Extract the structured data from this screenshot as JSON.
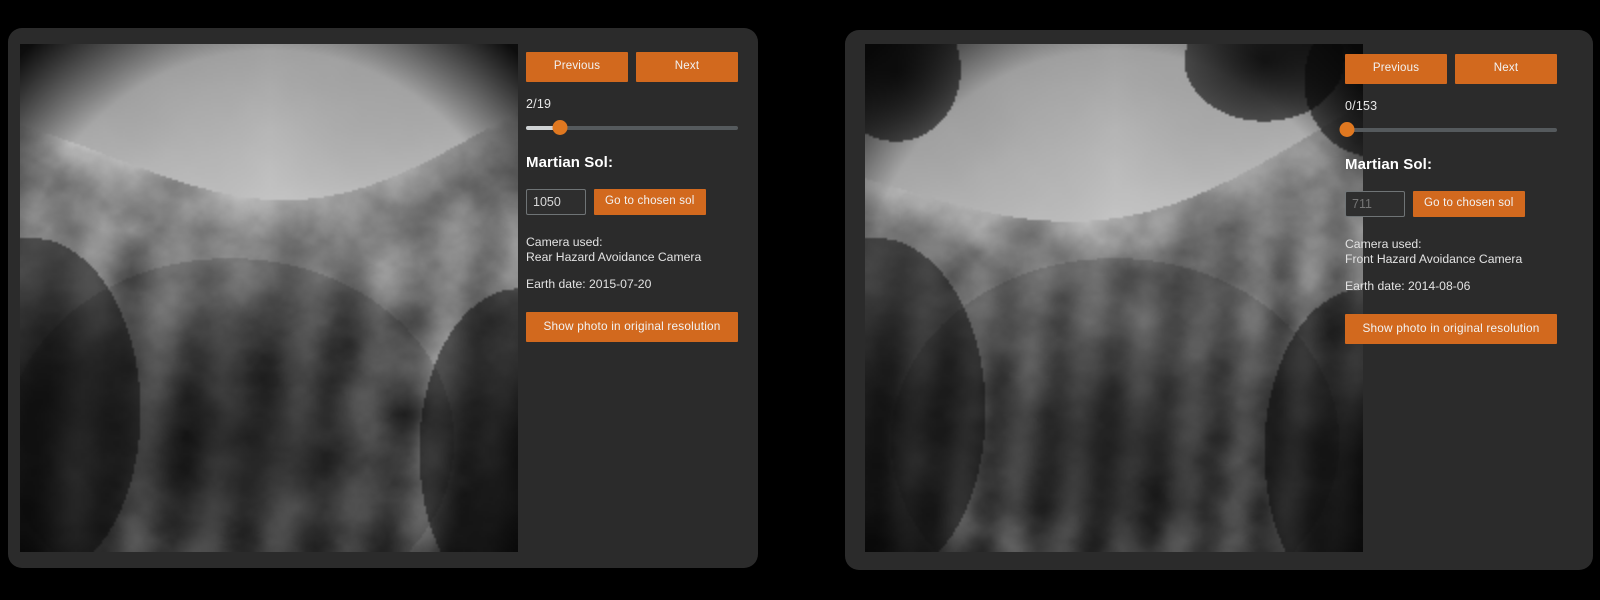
{
  "page": {
    "background_color": "#000000",
    "card_color": "#2b2b2b",
    "accent_color": "#d2691e"
  },
  "panels": [
    {
      "id": "left-panel",
      "image_alt": "Mars rover rear hazard avoidance camera photo",
      "controls": {
        "previous_label": "Previous",
        "next_label": "Next",
        "counter": "2/19",
        "slider": {
          "index": 2,
          "max": 19,
          "fill_percent": 16,
          "thumb_percent": 16
        },
        "sol_heading": "Martian Sol:",
        "sol_input_value": "1050",
        "sol_input_placeholder": "1050",
        "sol_input_is_placeholder": false,
        "go_label": "Go to chosen sol",
        "camera_label": "Camera used:",
        "camera_name": "Rear Hazard Avoidance Camera",
        "earth_date": "Earth date: 2015-07-20",
        "original_resolution_label": "Show photo in original resolution"
      }
    },
    {
      "id": "right-panel",
      "image_alt": "Mars rover front hazard avoidance camera photo",
      "controls": {
        "previous_label": "Previous",
        "next_label": "Next",
        "counter": "0/153",
        "slider": {
          "index": 0,
          "max": 153,
          "fill_percent": 0,
          "thumb_percent": 1
        },
        "sol_heading": "Martian Sol:",
        "sol_input_value": "711",
        "sol_input_placeholder": "711",
        "sol_input_is_placeholder": true,
        "go_label": "Go to chosen sol",
        "camera_label": "Camera used:",
        "camera_name": "Front Hazard Avoidance Camera",
        "earth_date": "Earth date: 2014-08-06",
        "original_resolution_label": "Show photo in original resolution"
      }
    }
  ]
}
